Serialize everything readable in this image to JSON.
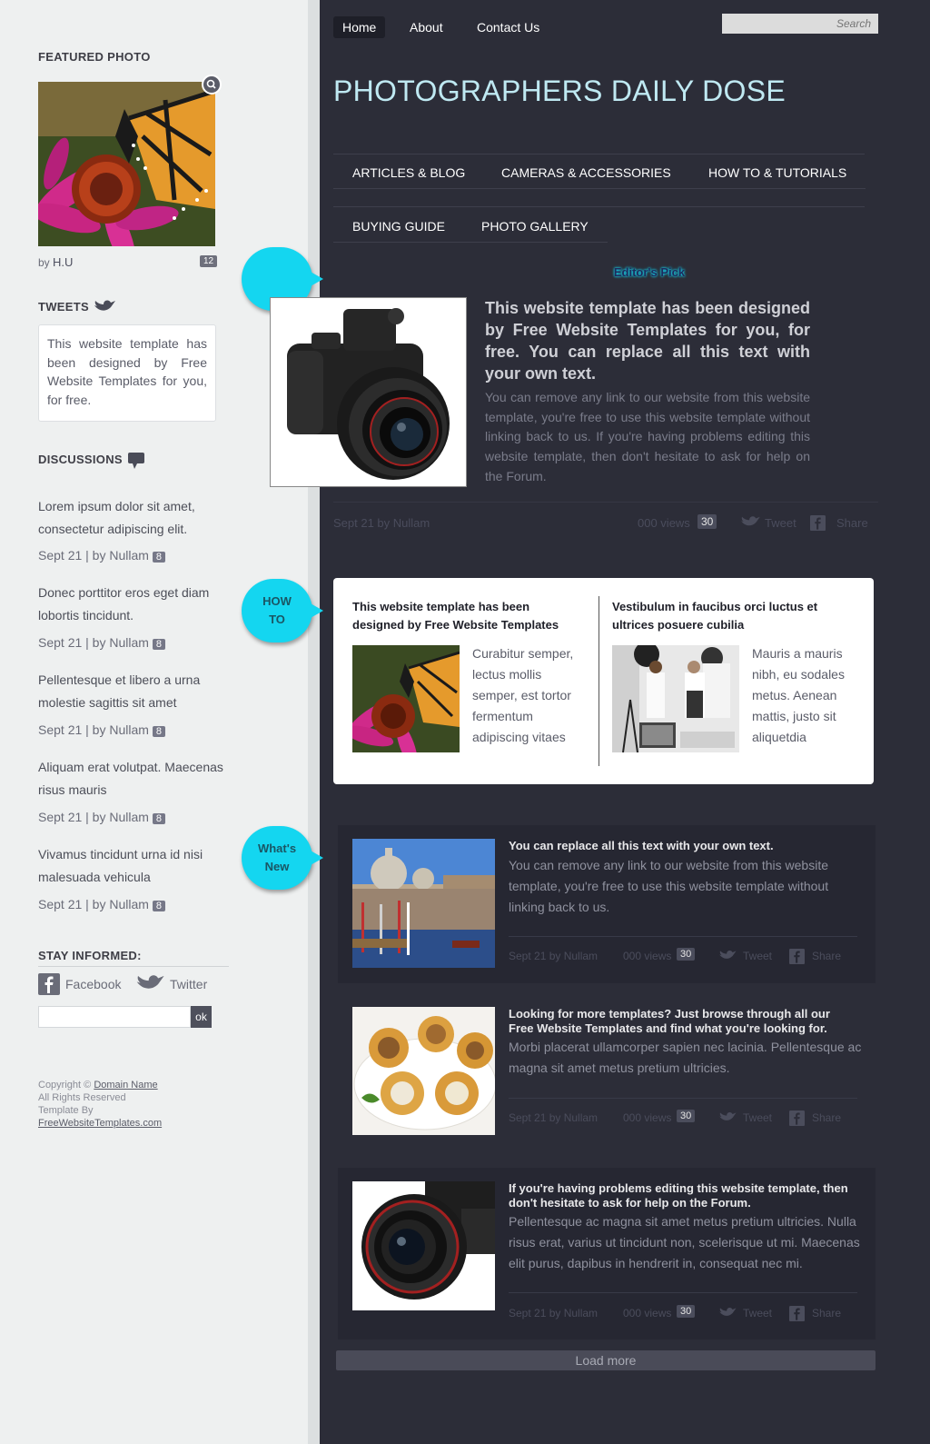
{
  "sidebar": {
    "featured_heading": "FEATURED PHOTO",
    "featured_by": "by",
    "featured_author": "H.U",
    "featured_count": "12",
    "tweets_heading": "TWEETS",
    "tweet_text": "This website template has been designed by Free Website Templates for you, for free.",
    "discussions_heading": "DISCUSSIONS",
    "discussions": [
      {
        "title": "Lorem ipsum dolor sit amet, consectetur adipiscing elit.",
        "meta": "Sept 21 | by Nullam",
        "count": "8"
      },
      {
        "title": "Donec porttitor eros eget diam lobortis tincidunt.",
        "meta": "Sept 21 | by Nullam",
        "count": "8"
      },
      {
        "title": "Pellentesque et libero a urna molestie sagittis sit amet",
        "meta": "Sept 21 | by Nullam",
        "count": "8"
      },
      {
        "title": "Aliquam erat volutpat. Maecenas risus mauris",
        "meta": "Sept 21 | by Nullam",
        "count": "8"
      },
      {
        "title": "Vivamus tincidunt urna id nisi malesuada vehicula",
        "meta": "Sept 21 | by Nullam",
        "count": "8"
      }
    ],
    "stay_heading": "STAY INFORMED:",
    "facebook_label": "Facebook",
    "twitter_label": "Twitter",
    "subscribe_button": "ok",
    "footer": {
      "copyright": "Copyright ©",
      "domain": "Domain Name",
      "rights": "All Rights Reserved",
      "template_by": "Template By",
      "fwt": "FreeWebsiteTemplates.com"
    }
  },
  "header": {
    "nav": [
      "Home",
      "About",
      "Contact Us"
    ],
    "search_placeholder": "Search",
    "site_title": "PHOTOGRAPHERS DAILY DOSE",
    "categories": [
      "ARTICLES & BLOG",
      "CAMERAS & ACCESSORIES",
      "HOW TO & TUTORIALS",
      "BUYING GUIDE",
      "PHOTO GALLERY"
    ]
  },
  "editors_pick": {
    "badge": "Editor's Pick",
    "title": "This website template has been designed by Free Website Templates for you, for free. You can replace all this text with your own text.",
    "body": "You can remove any link to our website from this website template, you're free to use this website template without linking back to us. If you're having problems editing this website template, then don't hesitate to ask for help on the Forum.",
    "meta": "Sept 21 by Nullam",
    "views": "000 views",
    "count": "30",
    "tweet": "Tweet",
    "share": "Share"
  },
  "howto": {
    "badge": "HOW TO",
    "items": [
      {
        "title": "This website template has been designed by Free Website Templates",
        "text": "Curabitur semper, lectus mollis semper, est tortor fermentum adipiscing vitaes"
      },
      {
        "title": "Vestibulum in faucibus orci luctus et ultrices posuere cubilia",
        "text": "Mauris a mauris nibh, eu sodales metus. Aenean mattis, justo sit aliquetdia"
      }
    ]
  },
  "whatsnew": {
    "badge": "What's New",
    "items": [
      {
        "title": "You can replace all this text with your own text.",
        "body": "You can remove any link to our website from this website template, you're free to use this website template without linking back to us.",
        "meta": "Sept 21 by Nullam",
        "views": "000 views",
        "count": "30",
        "tweet": "Tweet",
        "share": "Share"
      },
      {
        "title": "Looking for more templates? Just browse through all our Free Website Templates and find what you're looking for.",
        "body": "Morbi placerat ullamcorper sapien nec lacinia. Pellentesque ac magna sit amet metus pretium ultricies.",
        "meta": "Sept 21 by Nullam",
        "views": "000 views",
        "count": "30",
        "tweet": "Tweet",
        "share": "Share"
      },
      {
        "title": "If you're having problems editing this website template, then don't hesitate to ask for help on the Forum.",
        "body": "Pellentesque ac magna sit amet metus pretium ultricies. Nulla risus erat, varius ut tincidunt non, scelerisque ut mi. Maecenas elit purus, dapibus in hendrerit in, consequat nec mi.",
        "meta": "Sept 21 by Nullam",
        "views": "000 views",
        "count": "30",
        "tweet": "Tweet",
        "share": "Share"
      }
    ],
    "load_more": "Load more"
  },
  "colors": {
    "accent": "#14d6f0",
    "main_bg": "#2c2d38",
    "sidebar_bg": "#eef0f0"
  }
}
